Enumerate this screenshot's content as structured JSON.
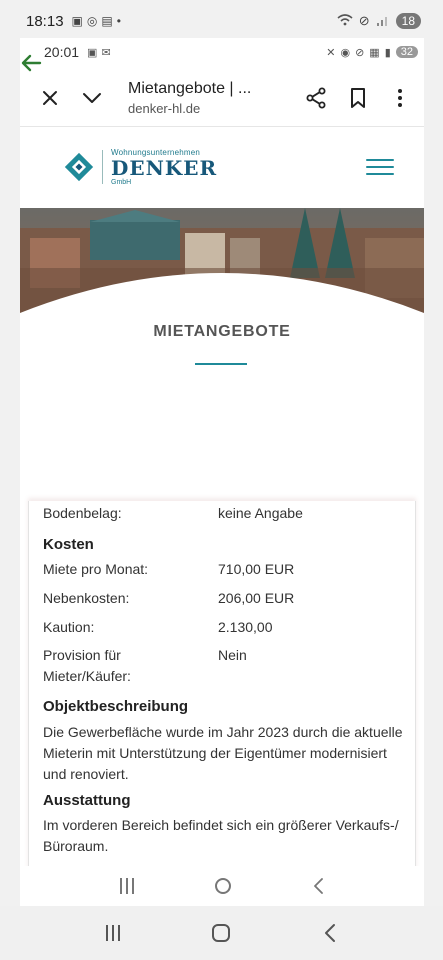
{
  "outer_status": {
    "time": "18:13",
    "battery": "18"
  },
  "inner_status": {
    "time": "20:01",
    "battery": "32"
  },
  "browser": {
    "title": "Mietangebote | ...",
    "domain": "denker-hl.de"
  },
  "logo": {
    "small": "Wohnungsunternehmen",
    "big": "DENKER",
    "gmbh": "GmbH"
  },
  "hero": {
    "title": "MIETANGEBOTE"
  },
  "details": {
    "bodenbelag_label": "Bodenbelag:",
    "bodenbelag_value": "keine Angabe",
    "kosten_heading": "Kosten",
    "miete_label": "Miete pro Monat:",
    "miete_value": "710,00 EUR",
    "neben_label": "Nebenkosten:",
    "neben_value": "206,00 EUR",
    "kaution_label": "Kaution:",
    "kaution_value": "2.130,00",
    "provision_label_1": "Provision für",
    "provision_label_2": "Mieter/Käufer:",
    "provision_value": "Nein",
    "objekt_heading": "Objektbeschreibung",
    "objekt_text": "Die Gewerbefläche wurde im Jahr 2023 durch die aktuelle Mieterin mit Unterstützung der Eigentümer modernisiert und renoviert.",
    "ausstattung_heading": "Ausstattung",
    "ausstattung_text": "Im vorderen Bereich befindet sich ein größerer Verkaufs-/ Büroraum."
  },
  "colors": {
    "accent": "#1f8a99",
    "logo_blue": "#17587a",
    "back_green": "#2e7d32"
  }
}
